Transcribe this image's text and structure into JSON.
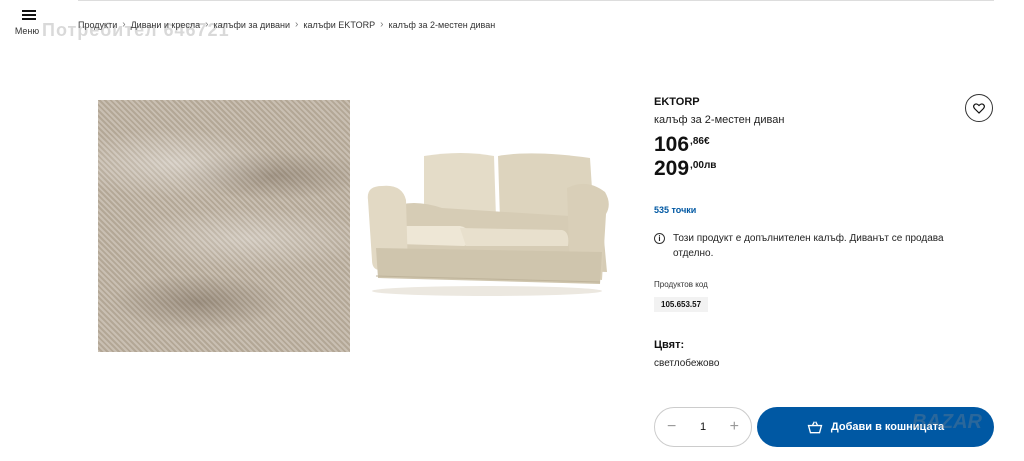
{
  "nav": {
    "menu_label": "Меню"
  },
  "watermark_top": "Потребител 646721",
  "breadcrumb": [
    "Продукти",
    "Дивани и кресла",
    "калъфи за дивани",
    "калъфи EKTORP",
    "калъф за 2-местен диван"
  ],
  "product": {
    "brand": "EKTORP",
    "description": "калъф за 2-местен диван",
    "price_eur_int": "106",
    "price_eur_dec": ",86€",
    "price_bgn_int": "209",
    "price_bgn_dec": ",00лв",
    "points": "535 точки",
    "notice": "Този продукт е допълнителен калъф. Диванът се продава отделно.",
    "code_label": "Продуктов код",
    "code": "105.653.57",
    "color_label": "Цвят:",
    "color_value": "светлобежово"
  },
  "cart": {
    "quantity": "1",
    "button_label": "Добави в кошницата"
  },
  "watermark_bottom": "BAZAR",
  "colors": {
    "accent": "#0058a3",
    "points": "#0058a3"
  }
}
